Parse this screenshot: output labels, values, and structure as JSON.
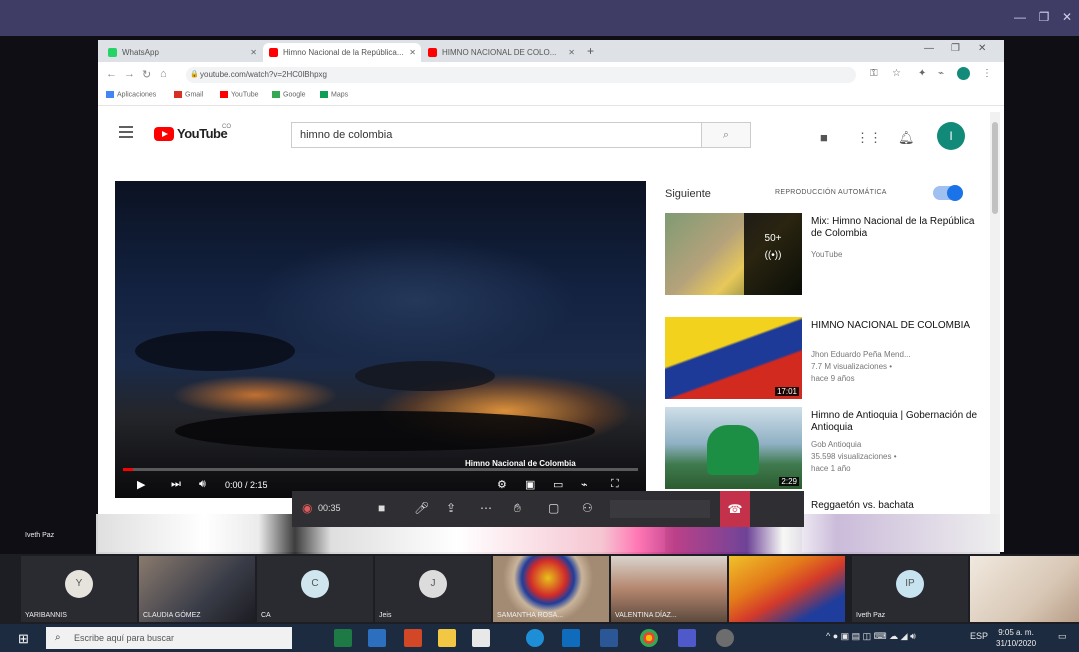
{
  "browser": {
    "tabs": [
      {
        "label": "WhatsApp",
        "color": "#25d366"
      },
      {
        "label": "Himno Nacional de la República...",
        "color": "#ff0000"
      },
      {
        "label": "HIMNO NACIONAL DE COLO...",
        "color": "#ff0000"
      }
    ],
    "new_tab": "+",
    "url": "youtube.com/watch?v=2HC0lBhpxg",
    "bookmarks": [
      "Aplicaciones",
      "Gmail",
      "YouTube",
      "Google",
      "Maps"
    ]
  },
  "youtube": {
    "logo_text": "YouTube",
    "country": "CO",
    "search_value": "himno de colombia",
    "player": {
      "caption": "Himno Nacional de Colombia",
      "time": "0:00 / 2:15",
      "progress_fraction": 0.02
    },
    "up_next": "Siguiente",
    "autoplay_label": "REPRODUCCIÓN AUTOMÁTICA",
    "recommendations": [
      {
        "title": "Mix: Himno Nacional de la República de Colombia",
        "meta1": "YouTube",
        "meta2": "",
        "duration": "",
        "mix_count": "50+"
      },
      {
        "title": "HIMNO NACIONAL DE COLOMBIA",
        "meta1": "Jhon Eduardo Peña Mend...",
        "meta2": "7.7 M visualizaciones •",
        "meta3": "hace 9 años",
        "duration": "17:01"
      },
      {
        "title": "Himno de Antioquia | Gobernación de Antioquia",
        "meta1": "Gob Antioquia",
        "meta2": "35.598 visualizaciones •",
        "meta3": "hace 1 año",
        "duration": "2:29"
      },
      {
        "title": "Reggaetón vs. bachata",
        "meta1": "",
        "meta2": "",
        "meta3": "",
        "duration": ""
      }
    ]
  },
  "meeting": {
    "timer": "00:35",
    "presenter": "Iveth Paz",
    "participants": [
      {
        "initial": "Y",
        "name": "YARIBANNIS"
      },
      {
        "initial": "",
        "name": "CLAUDIA GÓMEZ"
      },
      {
        "initial": "C",
        "name": "CA"
      },
      {
        "initial": "J",
        "name": "Jeis"
      },
      {
        "initial": "",
        "name": "SAMANTHA ROSA..."
      },
      {
        "initial": "",
        "name": "VALENTINA DÍAZ..."
      },
      {
        "initial": "",
        "name": ""
      },
      {
        "initial": "IP",
        "name": "Iveth Paz"
      },
      {
        "initial": "",
        "name": ""
      }
    ]
  },
  "taskbar": {
    "search_placeholder": "Escribe aquí para buscar",
    "time": "9:05 a. m.",
    "date": "31/10/2020",
    "tray_lang": "ESP"
  }
}
